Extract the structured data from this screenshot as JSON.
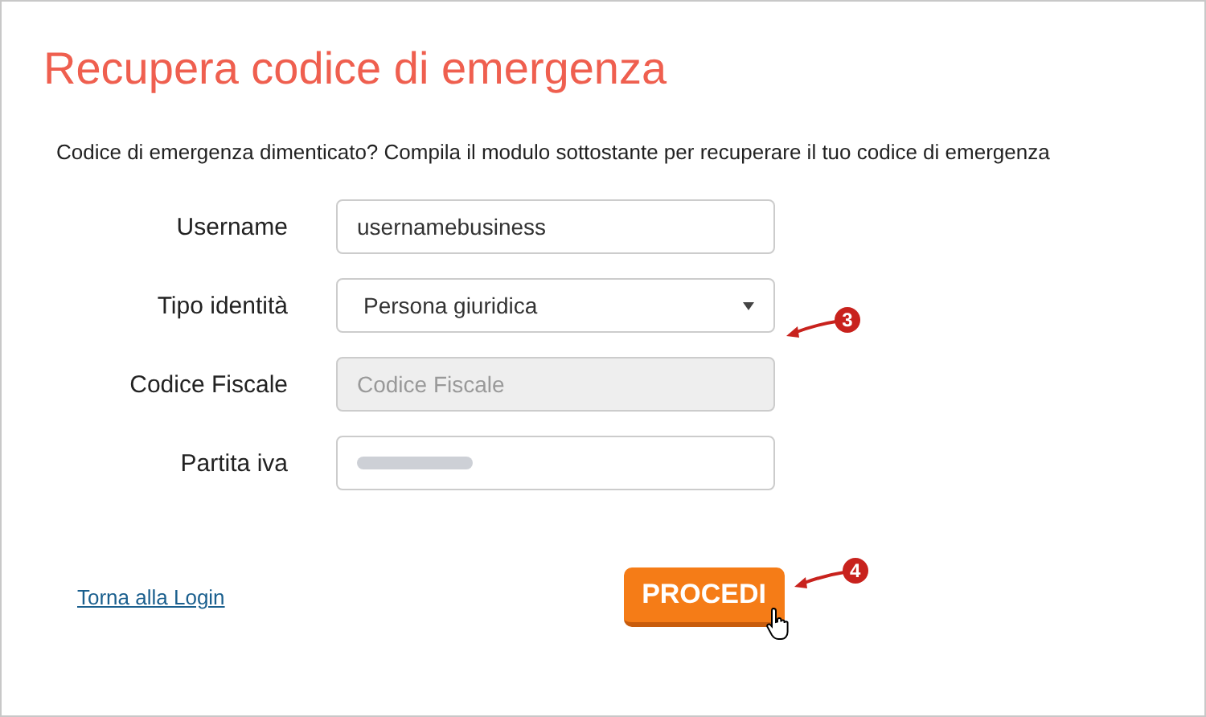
{
  "title": "Recupera codice di emergenza",
  "description": "Codice di emergenza dimenticato? Compila il modulo sottostante per recuperare il tuo codice di emergenza",
  "fields": [
    {
      "label": "Username",
      "kind": "text",
      "value": "usernamebusiness"
    },
    {
      "label": "Tipo identità",
      "kind": "select",
      "value": "Persona giuridica",
      "callout": "3"
    },
    {
      "label": "Codice Fiscale",
      "kind": "text",
      "placeholder": "Codice Fiscale",
      "disabled": true
    },
    {
      "label": "Partita iva",
      "kind": "redacted"
    }
  ],
  "back_link": "Torna alla Login",
  "submit": {
    "label": "PROCEDI",
    "callout": "4"
  }
}
